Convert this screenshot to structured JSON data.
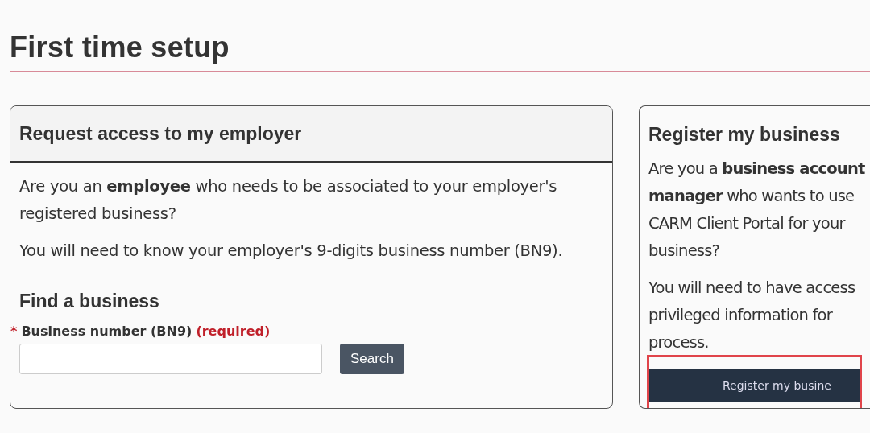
{
  "page": {
    "title": "First time setup"
  },
  "employer_panel": {
    "title": "Request access to my employer",
    "paragraphs": [
      "Are you an **employee** who needs to be associated to your employer's registered business?",
      "You will need to know your employer's 9-digits business number (BN9)."
    ],
    "section_title": "Find a business",
    "field": {
      "required_mark": "*",
      "label": "Business number (BN9)",
      "required_text": "(required)"
    },
    "button": "Search"
  },
  "business_panel": {
    "title": "Register my business",
    "paragraphs": [
      "Are you a **business account**",
      "**manager** who wants to use",
      "CARM Client Portal for your",
      "business?",
      "You will need to have access",
      "privileged information for",
      "process."
    ],
    "button": "Register my busine",
    "highlighted": true
  }
}
